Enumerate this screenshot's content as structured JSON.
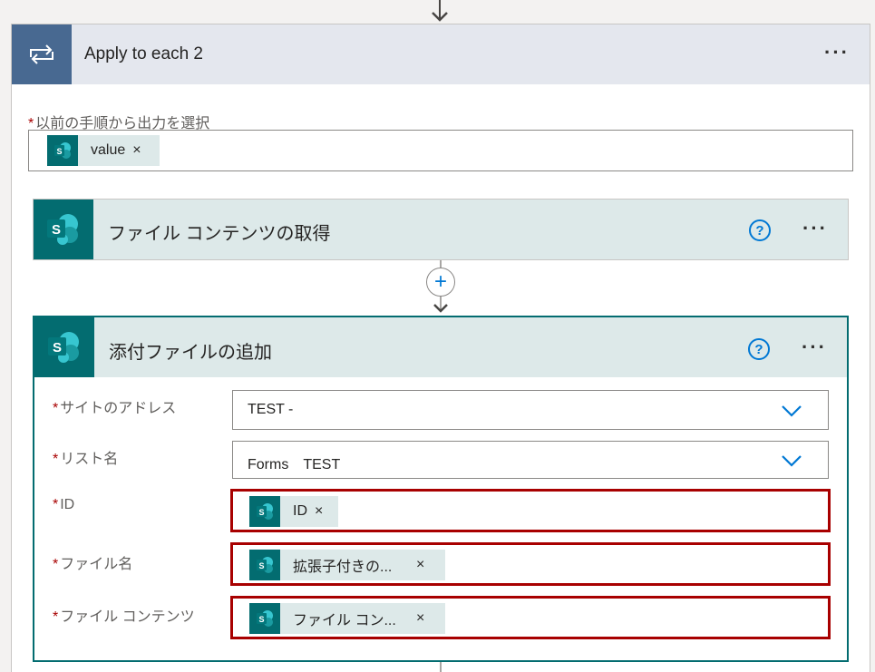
{
  "loop": {
    "title": "Apply to each 2",
    "menu": "···",
    "prev_step_label": "以前の手順から出力を選択",
    "value_token": "value"
  },
  "required_mark": "*",
  "remove_glyph": "×",
  "card1": {
    "title": "ファイル コンテンツの取得",
    "help": "?",
    "menu": "···"
  },
  "plus": "+",
  "card2": {
    "title": "添付ファイルの追加",
    "help": "?",
    "menu": "···",
    "fields": {
      "site": {
        "label": "サイトのアドレス",
        "value": "TEST -"
      },
      "list": {
        "label": "リスト名",
        "value": "Forms　TEST"
      },
      "id": {
        "label": "ID",
        "token": "ID"
      },
      "filename": {
        "label": "ファイル名",
        "token": "拡張子付きの..."
      },
      "content": {
        "label": "ファイル コンテンツ",
        "token": "ファイル コン..."
      }
    }
  },
  "colors": {
    "sharepoint_teal": "#036c70",
    "loop_blue": "#486991",
    "highlight_red": "#a80000",
    "link_blue": "#0078d4"
  }
}
